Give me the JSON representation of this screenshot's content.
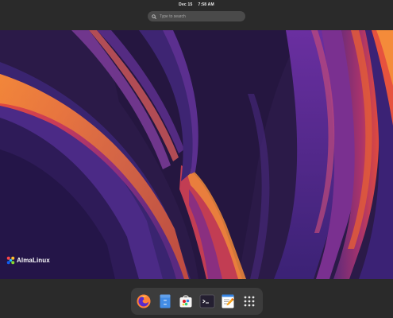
{
  "top_bar": {
    "date": "Dec 15",
    "time": "7:58 AM"
  },
  "search": {
    "placeholder": "Type to search",
    "icon": "search-icon"
  },
  "wallpaper": {
    "logo_text": "AlmaLinux"
  },
  "dock": {
    "apps": [
      {
        "name": "Firefox",
        "icon": "firefox-icon"
      },
      {
        "name": "Files",
        "icon": "files-icon"
      },
      {
        "name": "Software",
        "icon": "software-icon"
      },
      {
        "name": "Terminal",
        "icon": "terminal-icon"
      },
      {
        "name": "Text Editor",
        "icon": "text-editor-icon"
      },
      {
        "name": "Show Applications",
        "icon": "app-grid-icon"
      }
    ]
  }
}
